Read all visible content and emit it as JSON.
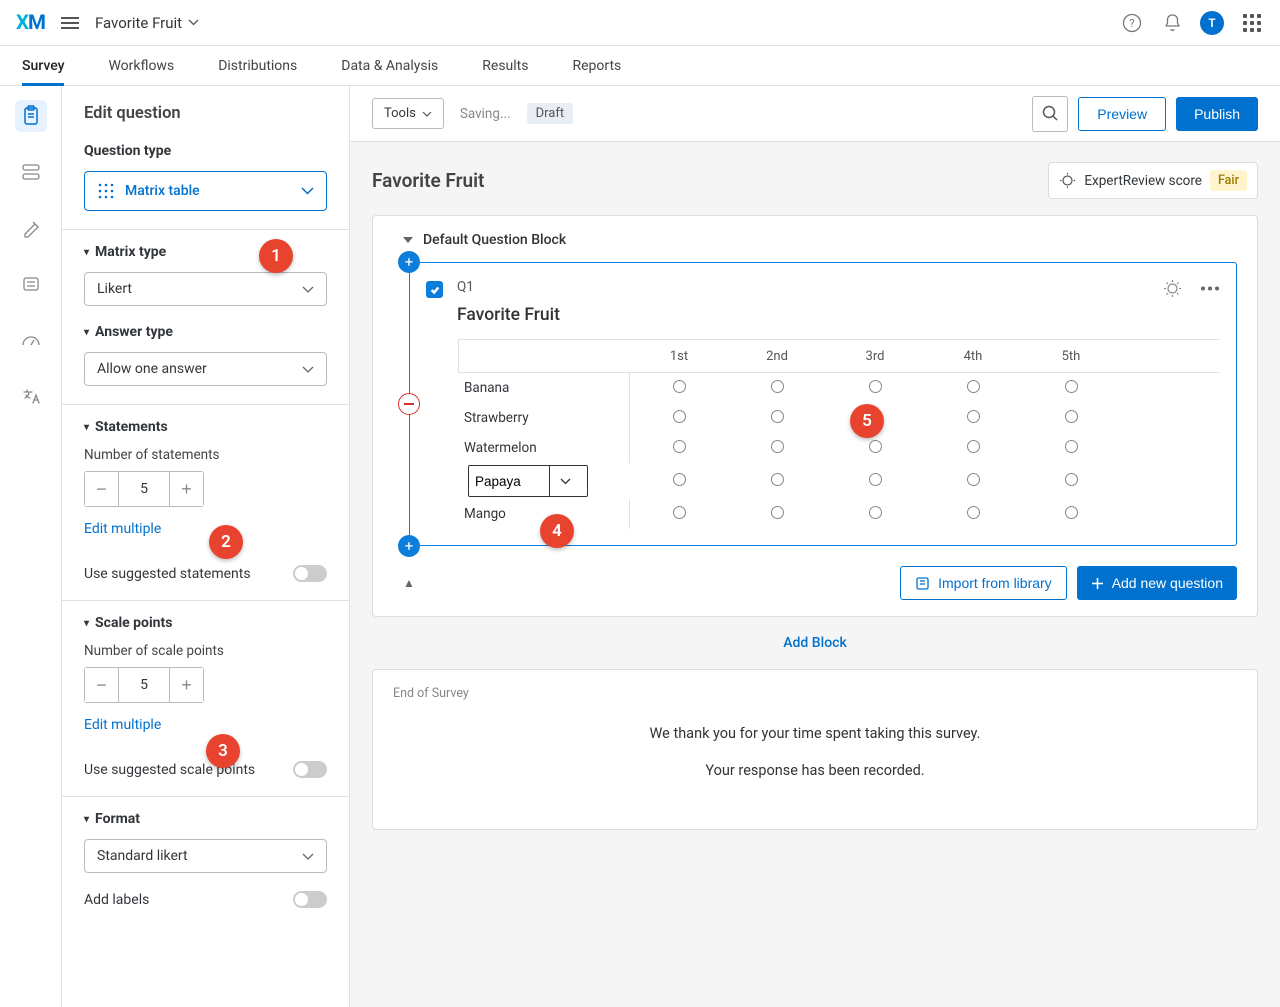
{
  "header": {
    "project": "Favorite Fruit",
    "avatar": "T"
  },
  "nav": [
    "Survey",
    "Workflows",
    "Distributions",
    "Data & Analysis",
    "Results",
    "Reports"
  ],
  "edit_panel": {
    "title": "Edit question",
    "question_type_label": "Question type",
    "question_type": "Matrix table",
    "matrix_type_header": "Matrix type",
    "matrix_type_value": "Likert",
    "answer_type_header": "Answer type",
    "answer_type_value": "Allow one answer",
    "statements_header": "Statements",
    "num_statements_label": "Number of statements",
    "num_statements": "5",
    "edit_multiple1": "Edit multiple",
    "use_suggested_statements": "Use suggested statements",
    "scale_points_header": "Scale points",
    "num_scale_label": "Number of scale points",
    "num_scale": "5",
    "edit_multiple2": "Edit multiple",
    "use_suggested_scale": "Use suggested scale points",
    "format_header": "Format",
    "format_value": "Standard likert",
    "add_labels": "Add labels"
  },
  "toolbar": {
    "tools": "Tools",
    "saving": "Saving...",
    "draft": "Draft",
    "preview": "Preview",
    "publish": "Publish"
  },
  "canvas": {
    "title": "Favorite Fruit",
    "expert_review": "ExpertReview score",
    "expert_badge": "Fair"
  },
  "block": {
    "name": "Default Question Block",
    "question": {
      "id": "Q1",
      "title": "Favorite Fruit",
      "scale": [
        "1st",
        "2nd",
        "3rd",
        "4th",
        "5th"
      ],
      "statements": [
        "Banana",
        "Strawberry",
        "Watermelon",
        "Papaya",
        "Mango"
      ],
      "editing_index": 3
    },
    "import": "Import from library",
    "add_question": "Add new question"
  },
  "add_block": "Add Block",
  "end": {
    "label": "End of Survey",
    "line1": "We thank you for your time spent taking this survey.",
    "line2": "Your response has been recorded."
  },
  "callouts": [
    "1",
    "2",
    "3",
    "4",
    "5"
  ]
}
